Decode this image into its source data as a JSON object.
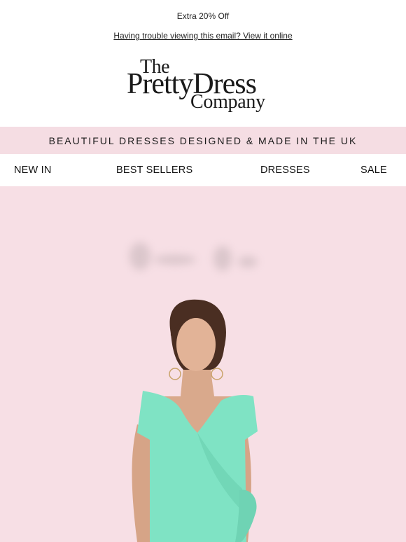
{
  "preheader": {
    "text": "Extra 20% Off"
  },
  "view_online": {
    "text": "Having trouble viewing this email? View it online"
  },
  "logo": {
    "line1": "The",
    "line2": "PrettyDress",
    "line3": "Company"
  },
  "banner": {
    "text": "BEAUTIFUL DRESSES DESIGNED & MADE IN THE UK"
  },
  "nav": {
    "items": [
      {
        "label": "NEW IN"
      },
      {
        "label": "BEST SELLERS"
      },
      {
        "label": "DRESSES"
      },
      {
        "label": "SALE"
      }
    ]
  },
  "hero": {
    "background": "#f7dfe5",
    "dress_color": "#7fe3c4",
    "skin_color": "#d9a98c",
    "hair_color": "#4a2e22"
  }
}
